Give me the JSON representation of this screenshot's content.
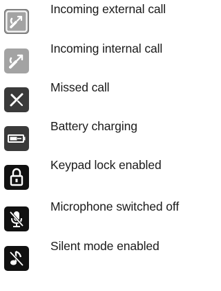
{
  "legend": {
    "items": [
      {
        "icon": "incoming-external-call-icon",
        "label": "Incoming external call"
      },
      {
        "icon": "incoming-internal-call-icon",
        "label": "Incoming internal call"
      },
      {
        "icon": "missed-call-icon",
        "label": "Missed call"
      },
      {
        "icon": "battery-charging-icon",
        "label": "Battery charging"
      },
      {
        "icon": "keypad-lock-icon",
        "label": "Keypad lock enabled"
      },
      {
        "icon": "microphone-off-icon",
        "label": "Microphone switched off"
      },
      {
        "icon": "silent-mode-icon",
        "label": "Silent mode enabled"
      }
    ]
  },
  "colors": {
    "light_icon_bg": "#9c9c9c",
    "light_icon_border": "#6e6e6e",
    "dark_icon_bg": "#111111",
    "medium_icon_bg": "#3a3a3a",
    "text": "#1a1a1a"
  }
}
